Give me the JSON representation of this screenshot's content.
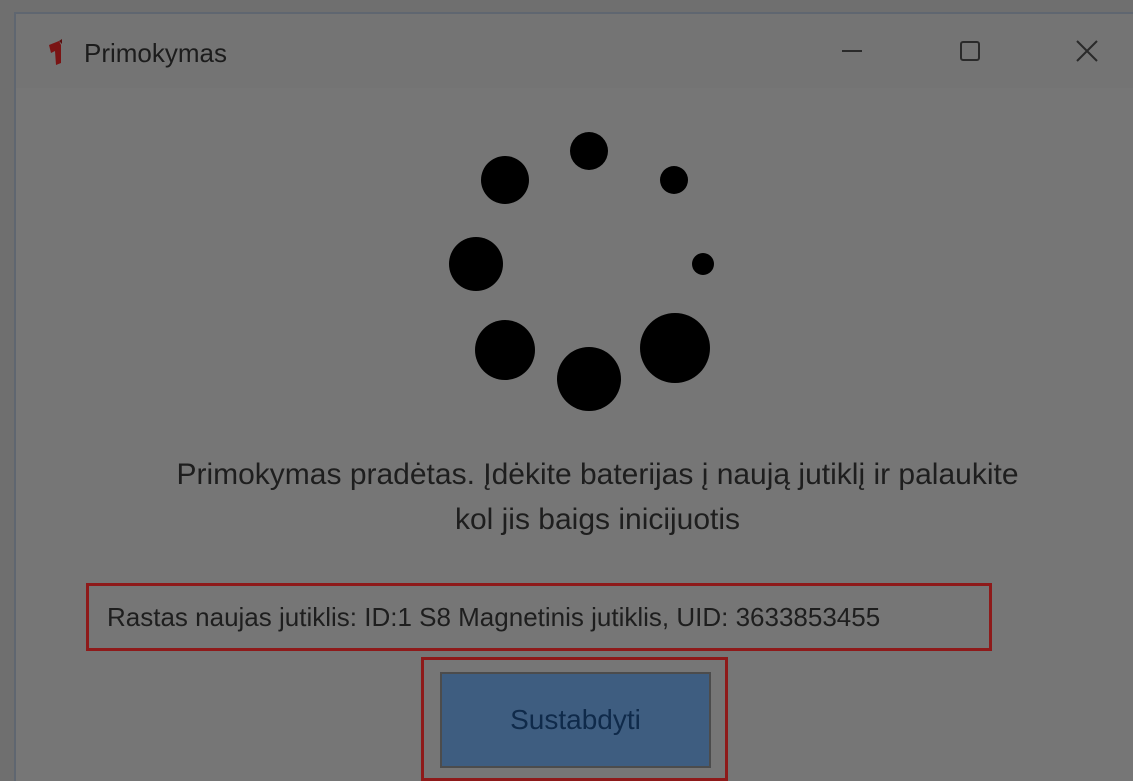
{
  "window": {
    "title": "Primokymas",
    "icon": "app-logo-icon"
  },
  "controls": {
    "minimize_icon": "minimize-icon",
    "maximize_icon": "maximize-icon",
    "close_icon": "close-icon"
  },
  "spinner": {
    "icon": "loading-spinner-icon"
  },
  "message": {
    "line1": "Primokymas pradėtas. Įdėkite baterijas į naują jutiklį ir palaukite",
    "line2": "kol jis baigs inicijuotis"
  },
  "status": {
    "text": "Rastas naujas jutiklis: ID:1 S8 Magnetinis jutiklis, UID: 3633853455"
  },
  "stop_button": {
    "label": "Sustabdyti"
  },
  "colors": {
    "overlay_bg": "#767676",
    "highlight_border": "#8e1a1a",
    "button_bg": "#3e5d80",
    "spinner": "#000000"
  }
}
